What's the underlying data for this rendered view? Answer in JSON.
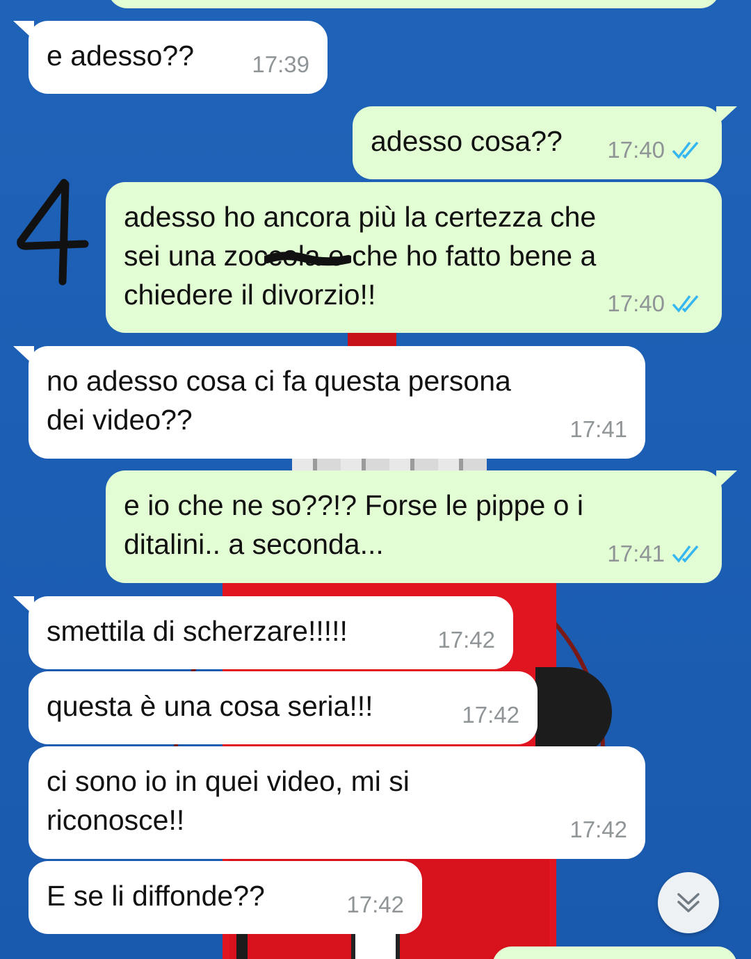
{
  "messages": [
    {
      "direction": "incoming",
      "text": "e adesso??",
      "time": "17:39"
    },
    {
      "direction": "outgoing",
      "text": "adesso cosa??",
      "time": "17:40",
      "status": "read"
    },
    {
      "direction": "outgoing",
      "text": "adesso ho ancora più la certezza che\nsei una zoccola e che ho fatto bene a\nchiedere il divorzio!!",
      "time": "17:40",
      "status": "read"
    },
    {
      "direction": "incoming",
      "text": "no adesso cosa ci fa questa persona\ndei video??",
      "time": "17:41"
    },
    {
      "direction": "outgoing",
      "text": "e io che ne so??!? Forse le pippe o i\nditalini.. a seconda...",
      "time": "17:41",
      "status": "read"
    },
    {
      "direction": "incoming",
      "text": "smettila di scherzare!!!!!",
      "time": "17:42"
    },
    {
      "direction": "incoming",
      "text": "questa è una cosa seria!!!",
      "time": "17:42"
    },
    {
      "direction": "incoming",
      "text": "ci sono io in quei video, mi si\nriconosce!!",
      "time": "17:42"
    },
    {
      "direction": "incoming",
      "text": "E se li diffonde??",
      "time": "17:42"
    }
  ],
  "annotation": {
    "label": "4"
  },
  "colors": {
    "incoming_bubble": "#ffffff",
    "outgoing_bubble": "#e2fcd3",
    "read_ticks": "#34b7f1",
    "timestamp": "#8f9497"
  },
  "icons": {
    "read_receipt": "double-check-icon",
    "scroll_down": "chevron-double-down-icon"
  }
}
